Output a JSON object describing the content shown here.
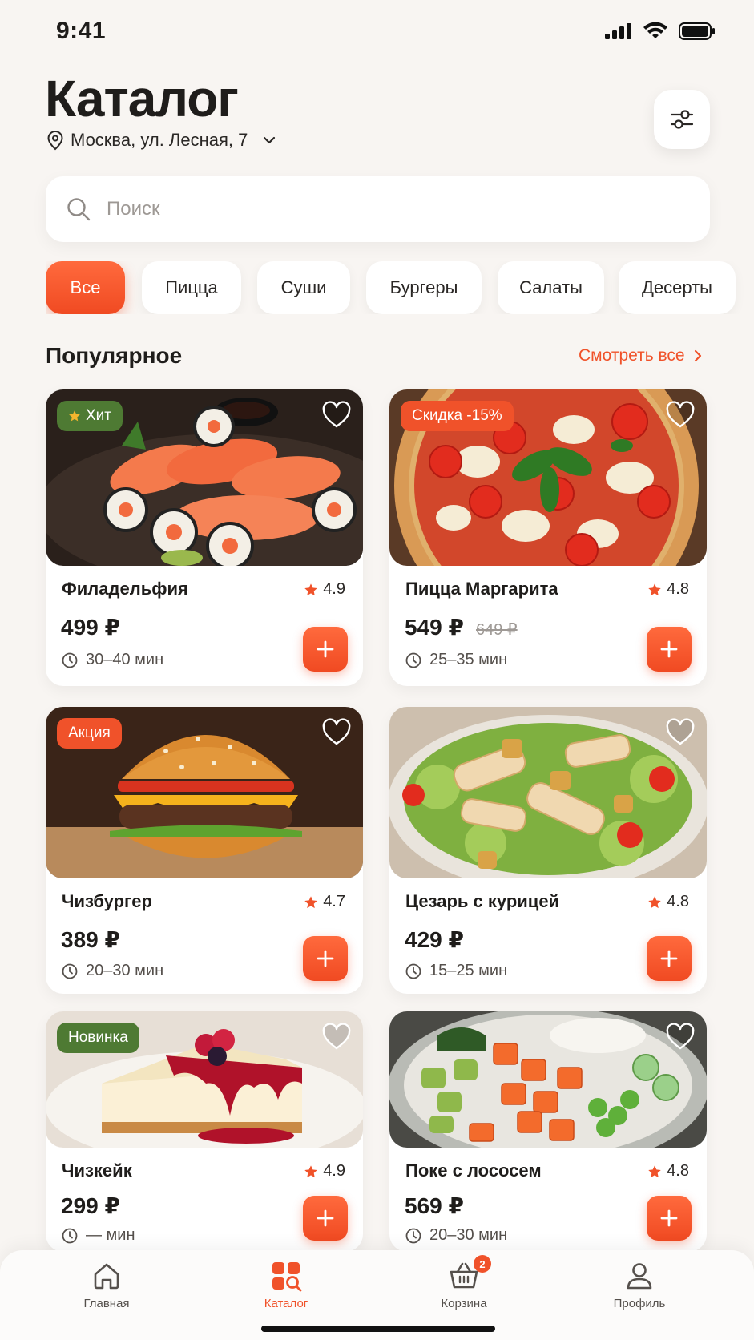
{
  "status": {
    "time": "9:41"
  },
  "header": {
    "title": "Каталог",
    "location": "Москва, ул. Лесная, 7"
  },
  "search": {
    "placeholder": "Поиск",
    "value": ""
  },
  "categories": [
    {
      "label": "Все",
      "active": true
    },
    {
      "label": "Пицца",
      "active": false
    },
    {
      "label": "Суши",
      "active": false
    },
    {
      "label": "Бургеры",
      "active": false
    },
    {
      "label": "Салаты",
      "active": false
    },
    {
      "label": "Десерты",
      "active": false
    }
  ],
  "section": {
    "title": "Популярное",
    "see_all": "Смотреть все"
  },
  "products": [
    {
      "name": "Филадельфия",
      "rating": "4.9",
      "price": "499 ₽",
      "old_price": "",
      "time": "30–40 мин",
      "badge": "Хит",
      "badge_color": "#4e7a33"
    },
    {
      "name": "Пицца Маргарита",
      "rating": "4.8",
      "price": "549 ₽",
      "old_price": "649 ₽",
      "time": "25–35 мин",
      "badge": "Скидка -15%",
      "badge_color": "#f0522a"
    },
    {
      "name": "Чизбургер",
      "rating": "4.7",
      "price": "389 ₽",
      "old_price": "",
      "time": "20–30 мин",
      "badge": "Акция",
      "badge_color": "#f0522a"
    },
    {
      "name": "Цезарь с курицей",
      "rating": "4.8",
      "price": "429 ₽",
      "old_price": "",
      "time": "15–25 мин",
      "badge": "",
      "badge_color": ""
    },
    {
      "name": "Чизкейк",
      "rating": "4.9",
      "price": "299 ₽",
      "old_price": "",
      "time": "— мин",
      "badge": "Новинка",
      "badge_color": "#4e7a33"
    },
    {
      "name": "Поке с лососем",
      "rating": "4.8",
      "price": "569 ₽",
      "old_price": "",
      "time": "20–30 мин",
      "badge": "",
      "badge_color": ""
    }
  ],
  "tabs": [
    {
      "label": "Главная",
      "icon": "home-icon",
      "active": false
    },
    {
      "label": "Каталог",
      "icon": "catalog-icon",
      "active": true
    },
    {
      "label": "Корзина",
      "icon": "basket-icon",
      "active": false,
      "badge": "2"
    },
    {
      "label": "Профиль",
      "icon": "profile-icon",
      "active": false
    }
  ],
  "colors": {
    "accent": "#f0522a",
    "green_badge": "#4e7a33",
    "background": "#f8f5f2"
  }
}
